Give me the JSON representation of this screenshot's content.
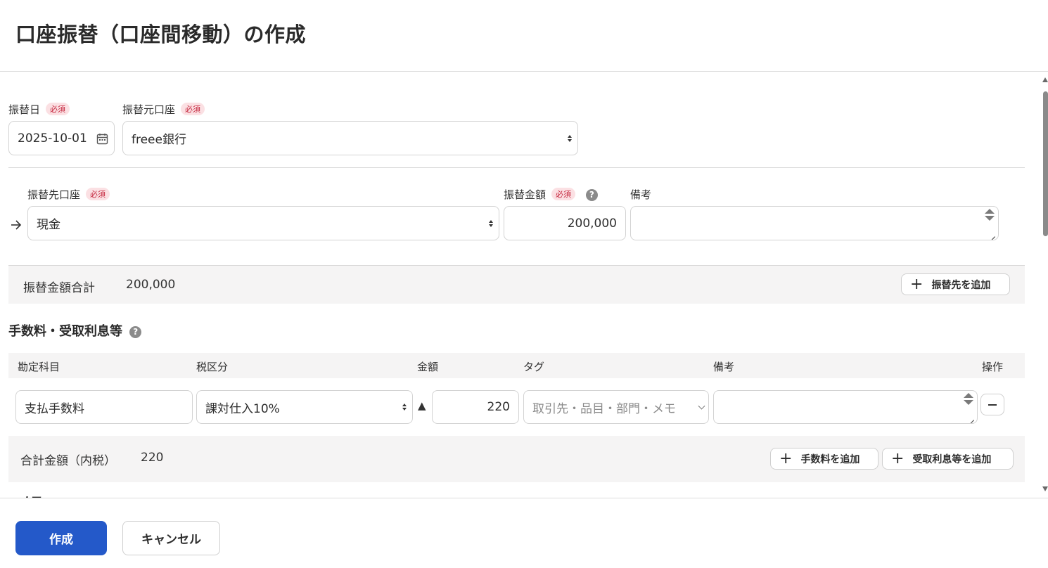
{
  "page": {
    "title": "口座振替（口座間移動）の作成"
  },
  "required_badge": "必須",
  "transfer": {
    "date_label": "振替日",
    "date_value": "2025-10-01",
    "source_label": "振替元口座",
    "source_value": "freee銀行"
  },
  "destination": {
    "account_label": "振替先口座",
    "account_value": "現金",
    "amount_label": "振替金額",
    "amount_value": "200,000",
    "memo_label": "備考",
    "memo_value": ""
  },
  "total": {
    "label": "振替金額合計",
    "value": "200,000",
    "add_destination_label": "振替先を追加"
  },
  "fees": {
    "heading": "手数料・受取利息等",
    "columns": [
      "勘定科目",
      "税区分",
      "金額",
      "タグ",
      "備考",
      "操作"
    ],
    "rows": [
      {
        "account": "支払手数料",
        "tax": "課対仕入10%",
        "direction": "▲",
        "amount": "220",
        "tag_placeholder": "取引先・品目・部門・メモ",
        "memo": ""
      }
    ],
    "total_label": "合計金額（内税）",
    "total_value": "220",
    "add_fee_label": "手数料を追加",
    "add_interest_label": "受取利息等を追加"
  },
  "next_section_partial": "メモ",
  "footer": {
    "create_label": "作成",
    "cancel_label": "キャンセル"
  },
  "icons": {
    "calendar": "calendar-icon",
    "arrow": "arrow-right-icon",
    "help": "help-icon",
    "plus": "plus-icon",
    "minus": "minus-icon"
  },
  "colors": {
    "primary": "#2459c9",
    "required_bg": "#fbe0e3",
    "required_text": "#c4253c",
    "band_bg": "#f5f4f4"
  }
}
